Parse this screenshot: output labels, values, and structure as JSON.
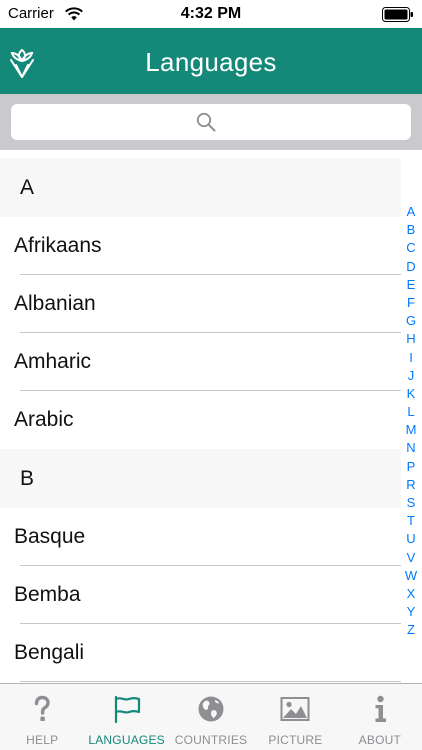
{
  "status_bar": {
    "carrier": "Carrier",
    "time": "4:32 PM"
  },
  "nav": {
    "title": "Languages"
  },
  "search": {
    "placeholder": ""
  },
  "sections": [
    {
      "header": "A",
      "items": [
        "Afrikaans",
        "Albanian",
        "Amharic",
        "Arabic"
      ]
    },
    {
      "header": "B",
      "items": [
        "Basque",
        "Bemba",
        "Bengali"
      ]
    }
  ],
  "index_letters": [
    "A",
    "B",
    "C",
    "D",
    "E",
    "F",
    "G",
    "H",
    "I",
    "J",
    "K",
    "L",
    "M",
    "N",
    "P",
    "R",
    "S",
    "T",
    "U",
    "V",
    "W",
    "X",
    "Y",
    "Z"
  ],
  "tabs": [
    {
      "label": "HELP",
      "icon": "question-icon",
      "active": false
    },
    {
      "label": "LANGUAGES",
      "icon": "flag-icon",
      "active": true
    },
    {
      "label": "COUNTRIES",
      "icon": "globe-icon",
      "active": false
    },
    {
      "label": "PICTURE",
      "icon": "picture-icon",
      "active": false
    },
    {
      "label": "ABOUT",
      "icon": "info-icon",
      "active": false
    }
  ],
  "colors": {
    "brand": "#14897a",
    "index_accent": "#007aff",
    "tab_inactive": "#8e8e93"
  }
}
